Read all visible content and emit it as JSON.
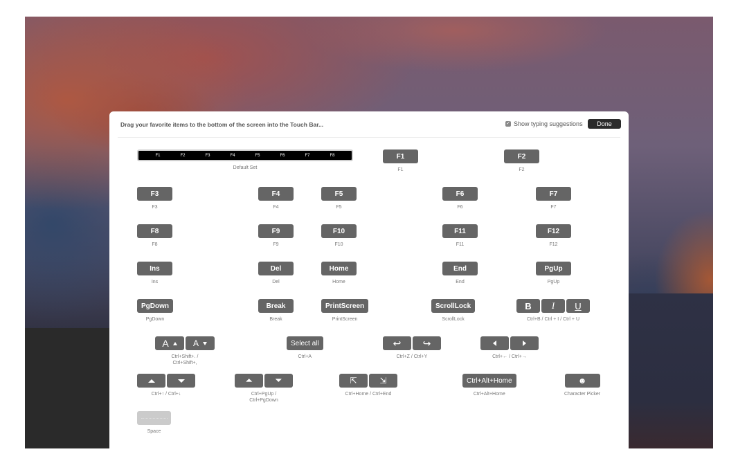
{
  "header": {
    "instructions": "Drag your favorite items to the bottom of the screen into the Touch Bar...",
    "show_suggestions_label": "Show typing suggestions",
    "show_suggestions_checked": true,
    "done_label": "Done"
  },
  "default_set": {
    "keys": [
      "F1",
      "F2",
      "F3",
      "F4",
      "F5",
      "F6",
      "F7",
      "F8"
    ],
    "label": "Default Set"
  },
  "items": {
    "f1": {
      "key": "F1",
      "label": "F1"
    },
    "f2": {
      "key": "F2",
      "label": "F2"
    },
    "f3": {
      "key": "F3",
      "label": "F3"
    },
    "f4": {
      "key": "F4",
      "label": "F4"
    },
    "f5": {
      "key": "F5",
      "label": "F5"
    },
    "f6": {
      "key": "F6",
      "label": "F6"
    },
    "f7": {
      "key": "F7",
      "label": "F7"
    },
    "f8": {
      "key": "F8",
      "label": "F8"
    },
    "f9": {
      "key": "F9",
      "label": "F9"
    },
    "f10": {
      "key": "F10",
      "label": "F10"
    },
    "f11": {
      "key": "F11",
      "label": "F11"
    },
    "f12": {
      "key": "F12",
      "label": "F12"
    },
    "ins": {
      "key": "Ins",
      "label": "Ins"
    },
    "del": {
      "key": "Del",
      "label": "Del"
    },
    "home": {
      "key": "Home",
      "label": "Home"
    },
    "end": {
      "key": "End",
      "label": "End"
    },
    "pgup": {
      "key": "PgUp",
      "label": "PgUp"
    },
    "pgdown": {
      "key": "PgDown",
      "label": "PgDown"
    },
    "break": {
      "key": "Break",
      "label": "Break"
    },
    "printscreen": {
      "key": "PrintScreen",
      "label": "PrintScreen"
    },
    "scrolllock": {
      "key": "ScrollLock",
      "label": "ScrollLock"
    },
    "biu": {
      "keys": [
        "B",
        "I",
        "U"
      ],
      "label": "Ctrl+B / Ctrl + I / Ctrl + U"
    },
    "fontsize": {
      "keys": [
        "A",
        "A"
      ],
      "label_line1": "Ctrl+Shift+. /",
      "label_line2": "Ctrl+Shift+,"
    },
    "selectall": {
      "key": "Select all",
      "label": "Ctrl+A"
    },
    "undoredo": {
      "label": "Ctrl+Z / Ctrl+Y"
    },
    "leftright": {
      "label": "Ctrl+← / Ctrl+→"
    },
    "updown": {
      "label": "Ctrl+↑ / Ctrl+↓"
    },
    "pgupdown": {
      "label_line1": "Ctrl+PgUp /",
      "label_line2": "Ctrl+PgDown"
    },
    "homeend": {
      "label": "Ctrl+Home / Ctrl+End"
    },
    "ctrlalthome": {
      "key": "Ctrl+Alt+Home",
      "label": "Ctrl+Alt+Home"
    },
    "charpicker": {
      "label": "Character Picker"
    },
    "space": {
      "label": "Space"
    }
  }
}
